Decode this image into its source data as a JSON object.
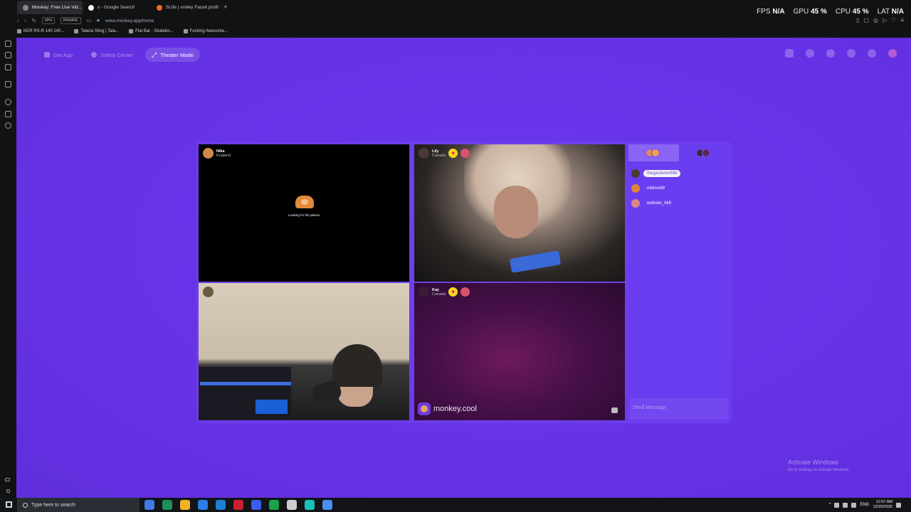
{
  "browser": {
    "tabs": [
      {
        "label": "Monkey: Free Live Vid..."
      },
      {
        "label": "x - Google Search"
      },
      {
        "label": "SLife | smiley Faceit profil"
      }
    ],
    "url": "www.monkey.app/home",
    "addr_chips": [
      "VPN",
      "PRIVATE"
    ],
    "bookmarks": [
      {
        "label": "M2R RS-R 140 140..."
      },
      {
        "label": "Talaria Sting | Tala..."
      },
      {
        "label": "Flat Bar - Skatebo..."
      },
      {
        "label": "Fucking Awesome..."
      }
    ]
  },
  "hud": {
    "fps_label": "FPS",
    "fps_value": "N/A",
    "gpu_label": "GPU",
    "gpu_value": "45 %",
    "cpu_label": "CPU",
    "cpu_value": "45 %",
    "lat_label": "LAT",
    "lat_value": "N/A"
  },
  "nav": {
    "get_app": "Get App",
    "safety_center": "Safety Center",
    "theater_mode": "Theater Mode"
  },
  "tiles": {
    "t1": {
      "name": "Nika",
      "country": "England",
      "status": "Looking for the places"
    },
    "t2": {
      "name": "Lily",
      "country": "Canada",
      "heart": "♥"
    },
    "t4": {
      "name": "Kay",
      "country": "Canada",
      "heart": "♥",
      "watermark": "monkey.cool"
    }
  },
  "chat": {
    "users": [
      {
        "name": "thegardener698",
        "highlighted": true
      },
      {
        "name": "nikluvs69",
        "highlighted": false
      },
      {
        "name": "webster_hk8",
        "highlighted": false
      }
    ],
    "placeholder": "Send Message"
  },
  "activate": {
    "title": "Activate Windows",
    "sub": "Go to Settings to activate Windows."
  },
  "taskbar": {
    "search_placeholder": "Type here to search",
    "lang": "ENG",
    "time": "12:07 AM",
    "date": "12/29/2025",
    "app_colors": [
      "#3f7be6",
      "#1e8f5a",
      "#f0b323",
      "#2b7de9",
      "#1c7fd4",
      "#cc2030",
      "#3a5ef0",
      "#19a34a",
      "#cccccc",
      "#17c2b5",
      "#4a8ef0"
    ]
  },
  "colors": {
    "page_bg": "#6a35e8",
    "accent": "#8a64f5"
  }
}
